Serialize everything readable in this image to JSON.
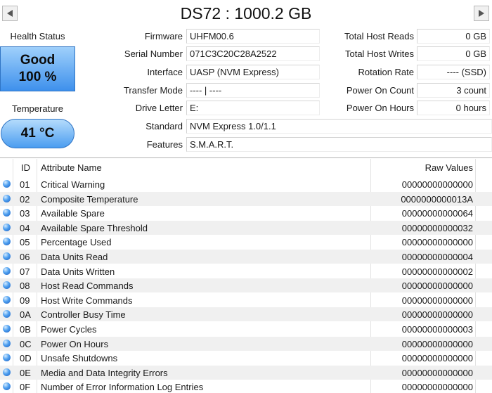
{
  "title": "DS72 : 1000.2 GB",
  "health": {
    "label": "Health Status",
    "status": "Good",
    "percent": "100 %"
  },
  "temperature": {
    "label": "Temperature",
    "value": "41 °C"
  },
  "info": {
    "firmware": {
      "label": "Firmware",
      "value": "UHFM00.6"
    },
    "serial": {
      "label": "Serial Number",
      "value": "071C3C20C28A2522"
    },
    "interface": {
      "label": "Interface",
      "value": "UASP (NVM Express)"
    },
    "transfer": {
      "label": "Transfer Mode",
      "value": "---- | ----"
    },
    "drive_letter": {
      "label": "Drive Letter",
      "value": "E:"
    },
    "standard": {
      "label": "Standard",
      "value": "NVM Express 1.0/1.1"
    },
    "features": {
      "label": "Features",
      "value": "S.M.A.R.T."
    }
  },
  "stats": {
    "reads": {
      "label": "Total Host Reads",
      "value": "0 GB"
    },
    "writes": {
      "label": "Total Host Writes",
      "value": "0 GB"
    },
    "rotation": {
      "label": "Rotation Rate",
      "value": "---- (SSD)"
    },
    "power_count": {
      "label": "Power On Count",
      "value": "3 count"
    },
    "power_hours": {
      "label": "Power On Hours",
      "value": "0 hours"
    }
  },
  "table": {
    "headers": {
      "id": "ID",
      "name": "Attribute Name",
      "raw": "Raw Values"
    },
    "rows": [
      {
        "id": "01",
        "name": "Critical Warning",
        "raw": "00000000000000"
      },
      {
        "id": "02",
        "name": "Composite Temperature",
        "raw": "0000000000013A"
      },
      {
        "id": "03",
        "name": "Available Spare",
        "raw": "00000000000064"
      },
      {
        "id": "04",
        "name": "Available Spare Threshold",
        "raw": "00000000000032"
      },
      {
        "id": "05",
        "name": "Percentage Used",
        "raw": "00000000000000"
      },
      {
        "id": "06",
        "name": "Data Units Read",
        "raw": "00000000000004"
      },
      {
        "id": "07",
        "name": "Data Units Written",
        "raw": "00000000000002"
      },
      {
        "id": "08",
        "name": "Host Read Commands",
        "raw": "00000000000000"
      },
      {
        "id": "09",
        "name": "Host Write Commands",
        "raw": "00000000000000"
      },
      {
        "id": "0A",
        "name": "Controller Busy Time",
        "raw": "00000000000000"
      },
      {
        "id": "0B",
        "name": "Power Cycles",
        "raw": "00000000000003"
      },
      {
        "id": "0C",
        "name": "Power On Hours",
        "raw": "00000000000000"
      },
      {
        "id": "0D",
        "name": "Unsafe Shutdowns",
        "raw": "00000000000000"
      },
      {
        "id": "0E",
        "name": "Media and Data Integrity Errors",
        "raw": "00000000000000"
      },
      {
        "id": "0F",
        "name": "Number of Error Information Log Entries",
        "raw": "00000000000000"
      }
    ]
  }
}
